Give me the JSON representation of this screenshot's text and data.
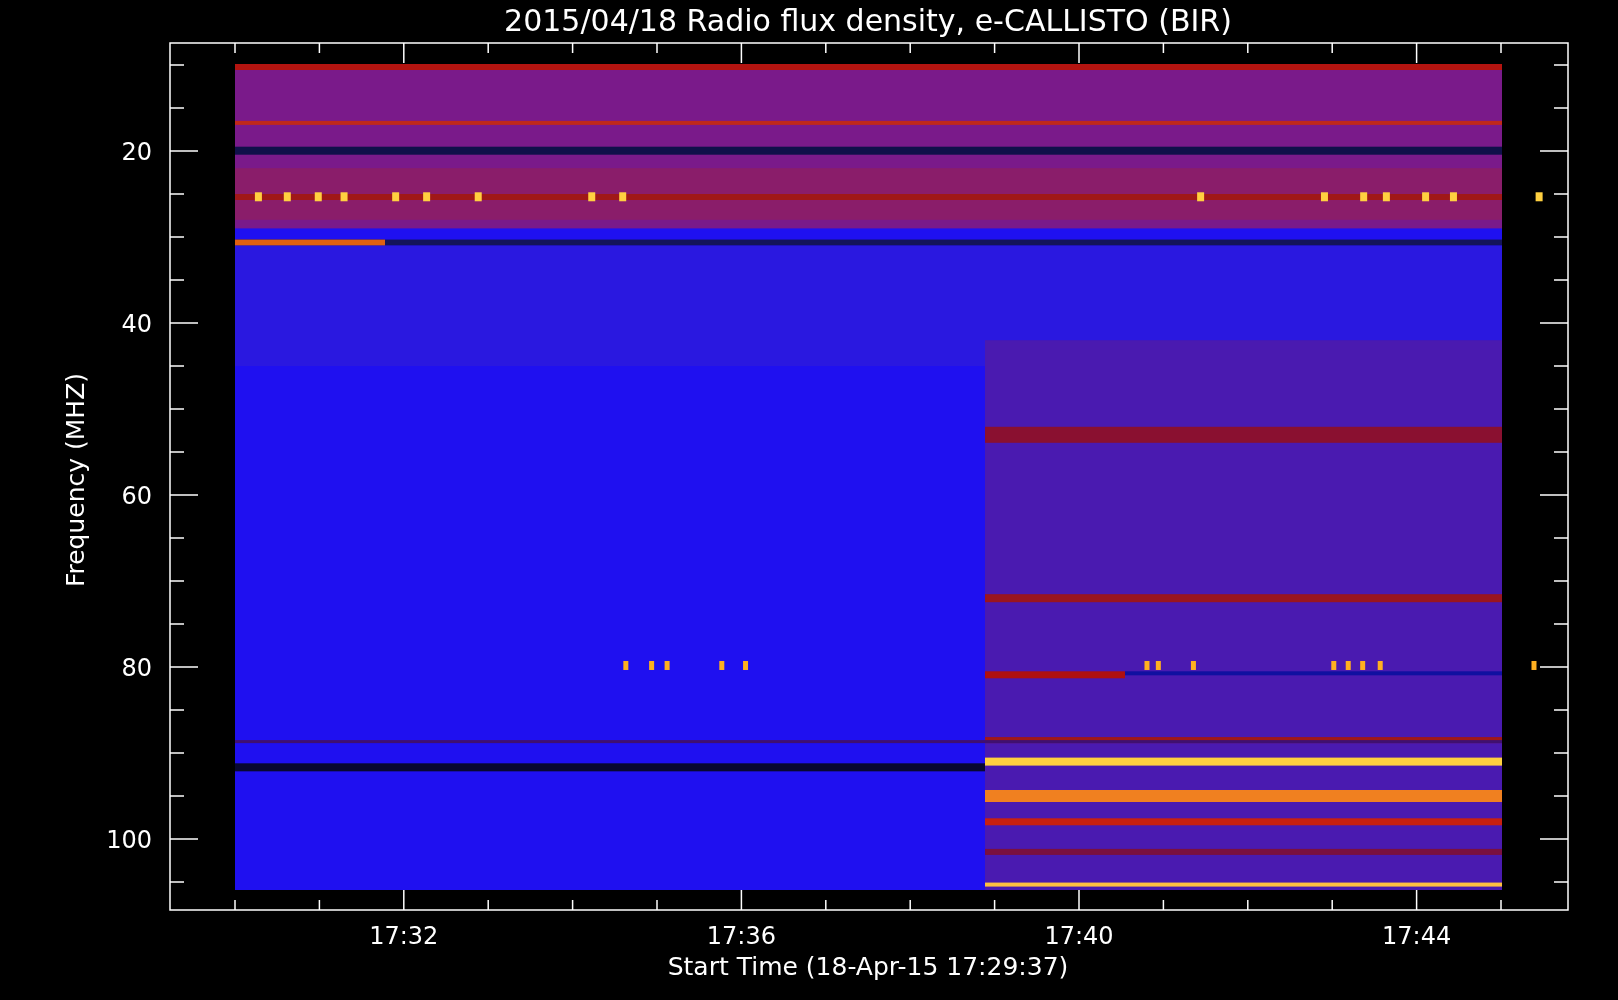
{
  "title": "2015/04/18  Radio flux density, e-CALLISTO (BIR)",
  "y_axis": {
    "label": "Frequency (MHZ)",
    "ticks": [
      "20",
      "40",
      "60",
      "80",
      "100"
    ]
  },
  "x_axis": {
    "label": "Start Time (18-Apr-15 17:29:37)",
    "ticks": [
      "17:32",
      "17:36",
      "17:40",
      "17:44"
    ]
  }
}
